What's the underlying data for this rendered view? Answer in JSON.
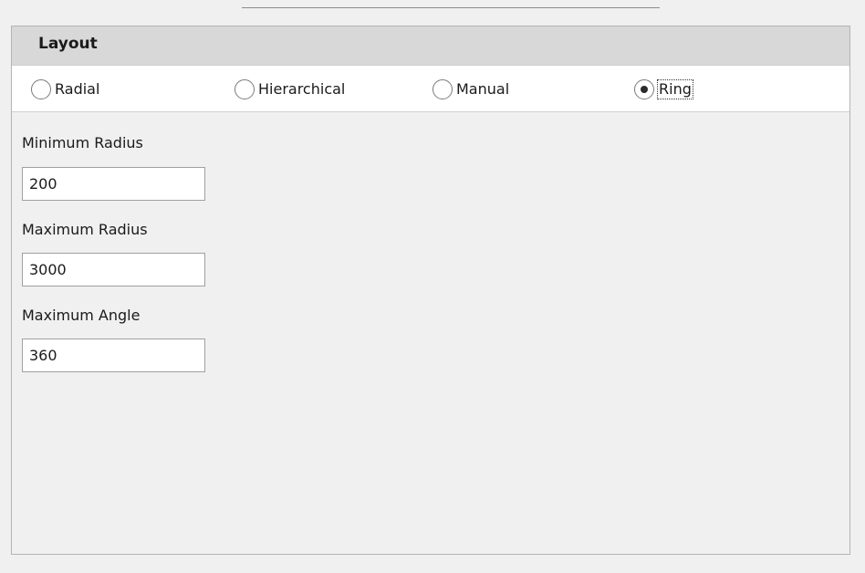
{
  "layout_panel": {
    "title": "Layout",
    "options": [
      {
        "label": "Radial",
        "selected": false
      },
      {
        "label": "Hierarchical",
        "selected": false
      },
      {
        "label": "Manual",
        "selected": false
      },
      {
        "label": "Ring",
        "selected": true
      }
    ]
  },
  "fields": {
    "min_radius": {
      "label": "Minimum Radius",
      "value": "200"
    },
    "max_radius": {
      "label": "Maximum Radius",
      "value": "3000"
    },
    "max_angle": {
      "label": "Maximum Angle",
      "value": "360"
    }
  }
}
